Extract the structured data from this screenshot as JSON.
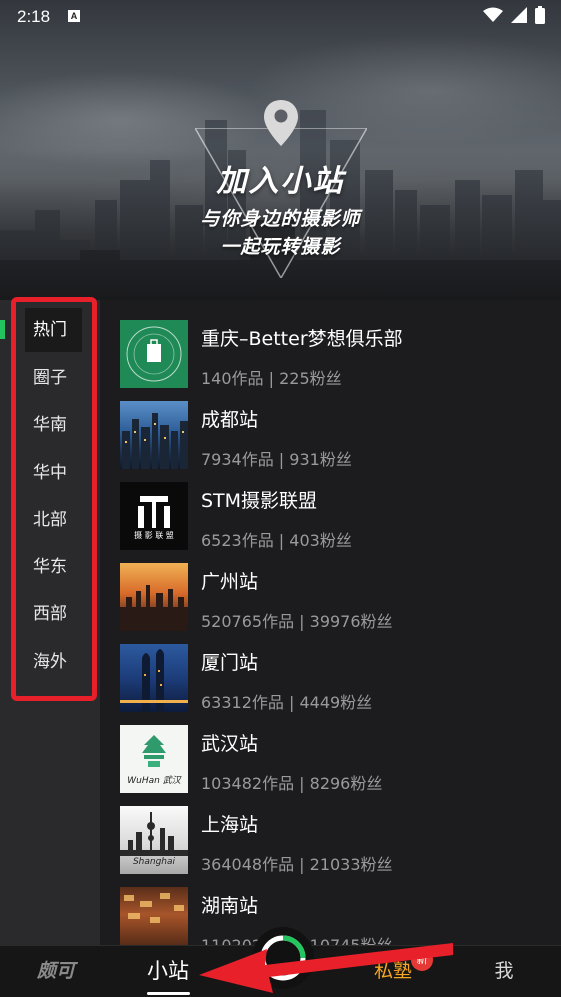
{
  "status_bar": {
    "time": "2:18",
    "notification_letter": "A"
  },
  "hero": {
    "title": "加入小站",
    "subtitle_line1": "与你身边的摄影师",
    "subtitle_line2": "一起玩转摄影"
  },
  "sidebar": {
    "items": [
      {
        "label": "热门",
        "active": true
      },
      {
        "label": "圈子"
      },
      {
        "label": "华南"
      },
      {
        "label": "华中"
      },
      {
        "label": "北部"
      },
      {
        "label": "华东"
      },
      {
        "label": "西部"
      },
      {
        "label": "海外"
      }
    ]
  },
  "stations": [
    {
      "title": "重庆–Better梦想俱乐部",
      "stats": "140作品 | 225粉丝"
    },
    {
      "title": "成都站",
      "stats": "7934作品 | 931粉丝"
    },
    {
      "title": "STM摄影联盟",
      "stats": "6523作品 | 403粉丝",
      "logo_text": "摄 影 联 盟"
    },
    {
      "title": "广州站",
      "stats": "520765作品 | 39976粉丝"
    },
    {
      "title": "厦门站",
      "stats": "63312作品 | 4449粉丝"
    },
    {
      "title": "武汉站",
      "stats": "103482作品 | 8296粉丝",
      "logo_text": "WuHan 武汉"
    },
    {
      "title": "上海站",
      "stats": "364048作品 | 21033粉丝",
      "logo_text": "Shanghai"
    },
    {
      "title": "湖南站",
      "stats": "110202作品 | 10745粉丝"
    }
  ],
  "bottom_nav": {
    "logo": "颇可",
    "station": "小站",
    "private": "私塾",
    "badge": "新",
    "me": "我"
  },
  "colors": {
    "accent_green": "#22c55e",
    "annotation_red": "#e8202a",
    "private_orange": "#f5a623",
    "badge_red": "#e53935"
  }
}
